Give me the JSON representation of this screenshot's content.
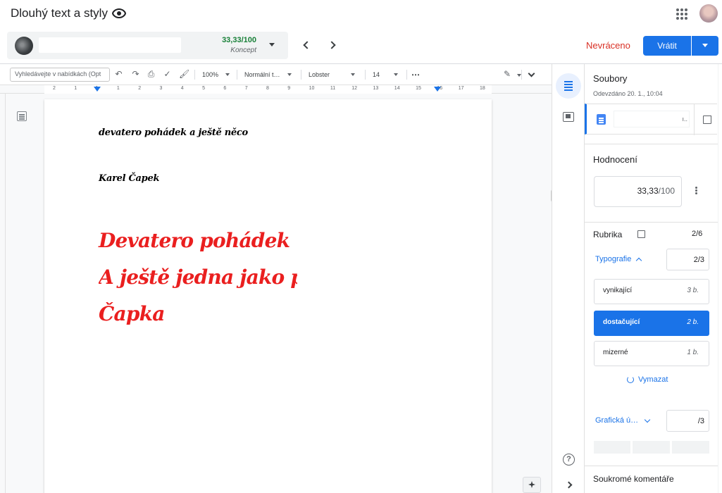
{
  "header": {
    "title": "Dlouhý text a styly"
  },
  "student": {
    "score": "33,33/100",
    "status": "Koncept"
  },
  "actions": {
    "not_returned": "Nevráceno",
    "return_label": "Vrátit"
  },
  "toolbar": {
    "menu_search_placeholder": "Vyhledávejte v nabídkách (Opt",
    "zoom": "100%",
    "style": "Normální t…",
    "font": "Lobster",
    "size": "14",
    "more": "⋯"
  },
  "ruler": {
    "marks": [
      "2",
      "1",
      "1",
      "1",
      "2",
      "3",
      "4",
      "5",
      "6",
      "7",
      "8",
      "9",
      "10",
      "11",
      "12",
      "13",
      "14",
      "15",
      "16",
      "17",
      "18"
    ]
  },
  "document": {
    "line1": "devatero pohádek a ještě něco",
    "line2": "Karel Čapek",
    "heading1": "Devatero pohádek",
    "heading2": "A ještě jedna jako přívažek",
    "heading3": "Čapka"
  },
  "panel": {
    "files_title": "Soubory",
    "submitted": "Odevzdáno 20. 1., 10:04",
    "file_name_tail": "ı..",
    "grade_title": "Hodnocení",
    "grade_value": "33,33",
    "grade_denominator": "/100",
    "rubric_title": "Rubrika",
    "rubric_count": "2/6",
    "criteria": [
      {
        "name": "Typografie",
        "score": "2/3",
        "levels": [
          {
            "name": "vynikající",
            "points": "3 b."
          },
          {
            "name": "dostačující",
            "points": "2 b."
          },
          {
            "name": "mizerné",
            "points": "1 b."
          }
        ]
      },
      {
        "name": "Grafická ú…",
        "score": "/3"
      }
    ],
    "clear_label": "Vymazat",
    "private_comments_title": "Soukromé komentáře"
  },
  "colors": {
    "accent": "#1a73e8",
    "score_green": "#188038",
    "not_returned_red": "#d93025",
    "doc_heading_red": "#ea1f1f"
  }
}
